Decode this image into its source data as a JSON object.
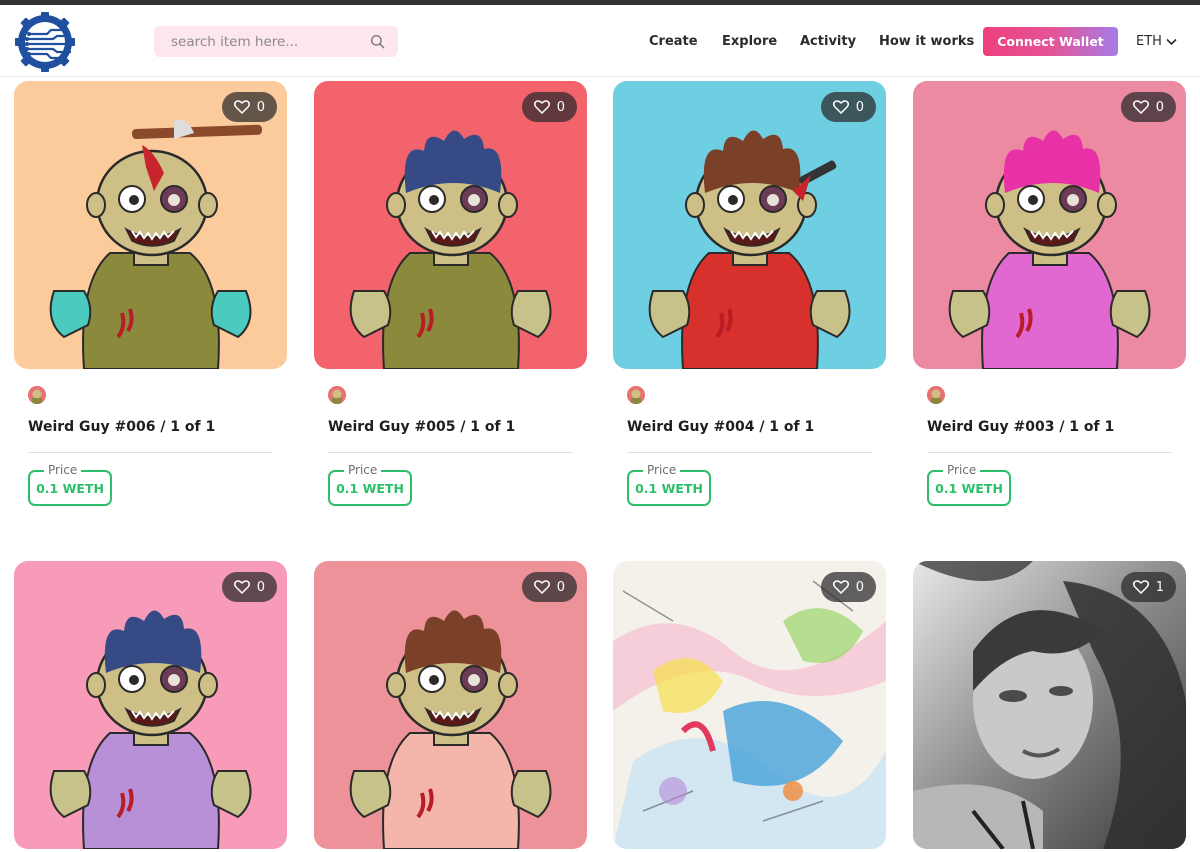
{
  "header": {
    "search": {
      "placeholder": "search item here..."
    },
    "nav": [
      "Create",
      "Explore",
      "Activity",
      "How it works"
    ],
    "connect_wallet": "Connect Wallet",
    "chain": "ETH"
  },
  "cards": [
    {
      "title": "Weird Guy #006 / 1 of 1",
      "likes": "0",
      "price_label": "Price",
      "price": "0.1 WETH",
      "bg": "#fccb9b",
      "hair": "none",
      "skin": "#cdbf86",
      "shirt": "#8b8a3c",
      "hands": "#4bcbc0",
      "extra": "axe"
    },
    {
      "title": "Weird Guy #005 / 1 of 1",
      "likes": "0",
      "price_label": "Price",
      "price": "0.1 WETH",
      "bg": "#f2636c",
      "hair": "#364a86",
      "skin": "#cdbf86",
      "shirt": "#8b8a3c",
      "hands": "#c7c28a",
      "extra": "none"
    },
    {
      "title": "Weird Guy #004 / 1 of 1",
      "likes": "0",
      "price_label": "Price",
      "price": "0.1 WETH",
      "bg": "#6ecfe3",
      "hair": "#7a4028",
      "skin": "#cdbf86",
      "shirt": "#d8312d",
      "hands": "#c7c28a",
      "extra": "knife"
    },
    {
      "title": "Weird Guy #003 / 1 of 1",
      "likes": "0",
      "price_label": "Price",
      "price": "0.1 WETH",
      "bg": "#ec8aa2",
      "hair": "#e830a7",
      "skin": "#cdbf86",
      "shirt": "#e068d0",
      "hands": "#c7c28a",
      "extra": "none"
    },
    {
      "title": "",
      "likes": "0",
      "bg": "#f89bb8",
      "hair": "#364a86",
      "skin": "#cdbf86",
      "shirt": "#b790d8",
      "hands": "#c7c28a",
      "extra": "none"
    },
    {
      "title": "",
      "likes": "0",
      "bg": "#ee9299",
      "hair": "#7a4028",
      "skin": "#cdbf86",
      "shirt": "#f4b5ab",
      "hands": "#c7c28a",
      "extra": "none"
    },
    {
      "title": "",
      "likes": "0",
      "bg": "#f4f0ea",
      "art": "abstract"
    },
    {
      "title": "",
      "likes": "1",
      "bg": "#9c9c9c",
      "art": "photo"
    }
  ]
}
